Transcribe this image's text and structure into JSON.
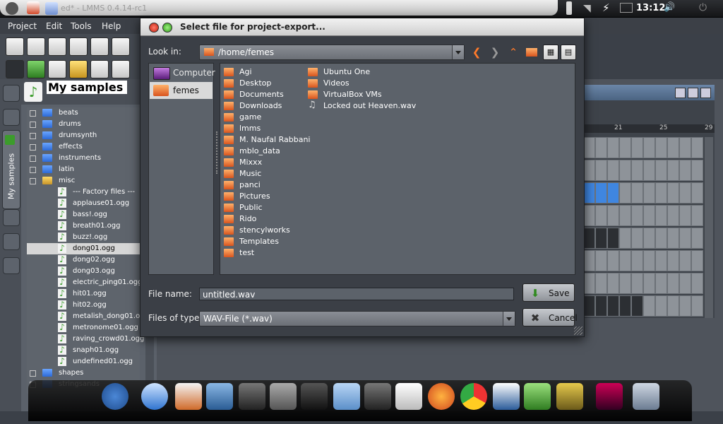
{
  "topbar": {
    "window_title": "ed* - LMMS 0.4.14-rc1",
    "clock": "13:12"
  },
  "menubar": {
    "items": [
      "Project",
      "Edit",
      "Tools",
      "Help"
    ]
  },
  "browser": {
    "title": "My samples",
    "sidetab_label": "My samples",
    "tree": [
      {
        "label": "beats",
        "kind": "folder"
      },
      {
        "label": "drums",
        "kind": "folder"
      },
      {
        "label": "drumsynth",
        "kind": "folder"
      },
      {
        "label": "effects",
        "kind": "folder"
      },
      {
        "label": "instruments",
        "kind": "folder"
      },
      {
        "label": "latin",
        "kind": "folder"
      },
      {
        "label": "misc",
        "kind": "folder-open"
      },
      {
        "label": "--- Factory files ---",
        "kind": "file"
      },
      {
        "label": "applause01.ogg",
        "kind": "file"
      },
      {
        "label": "bass!.ogg",
        "kind": "file"
      },
      {
        "label": "breath01.ogg",
        "kind": "file"
      },
      {
        "label": "buzz!.ogg",
        "kind": "file"
      },
      {
        "label": "dong01.ogg",
        "kind": "file",
        "selected": true
      },
      {
        "label": "dong02.ogg",
        "kind": "file"
      },
      {
        "label": "dong03.ogg",
        "kind": "file"
      },
      {
        "label": "electric_ping01.ogg",
        "kind": "file"
      },
      {
        "label": "hit01.ogg",
        "kind": "file"
      },
      {
        "label": "hit02.ogg",
        "kind": "file"
      },
      {
        "label": "metalish_dong01.ogg",
        "kind": "file"
      },
      {
        "label": "metronome01.ogg",
        "kind": "file"
      },
      {
        "label": "raving_crowd01.ogg",
        "kind": "file"
      },
      {
        "label": "snaph01.ogg",
        "kind": "file"
      },
      {
        "label": "undefined01.ogg",
        "kind": "file"
      },
      {
        "label": "shapes",
        "kind": "folder"
      },
      {
        "label": "stringsands",
        "kind": "folder"
      }
    ]
  },
  "song_editor": {
    "ruler": [
      "21",
      "25",
      "29"
    ]
  },
  "dialog": {
    "title": "Select file for project-export...",
    "look_in_label": "Look in:",
    "look_in_value": "/home/femes",
    "places": [
      {
        "label": "Computer",
        "icon": "computer-icon"
      },
      {
        "label": "femes",
        "icon": "home-folder-icon",
        "selected": true
      }
    ],
    "files_col1": [
      "Agi",
      "Desktop",
      "Documents",
      "Downloads",
      "game",
      "lmms",
      "M. Naufal Rabbani",
      "mblo_data",
      "Mixxx",
      "Music",
      "panci",
      "Pictures",
      "Public",
      "Rido",
      "stencylworks",
      "Templates",
      "test"
    ],
    "files_col2": [
      {
        "label": "Ubuntu One",
        "kind": "folder"
      },
      {
        "label": "Videos",
        "kind": "folder"
      },
      {
        "label": "VirtualBox VMs",
        "kind": "folder"
      },
      {
        "label": "Locked out Heaven.wav",
        "kind": "audio"
      }
    ],
    "file_name_label": "File name:",
    "file_name_value": "untitled.wav",
    "file_type_label": "Files of type:",
    "file_type_value": "WAV-File (*.wav)",
    "save_label": "Save",
    "cancel_label": "Cancel"
  }
}
